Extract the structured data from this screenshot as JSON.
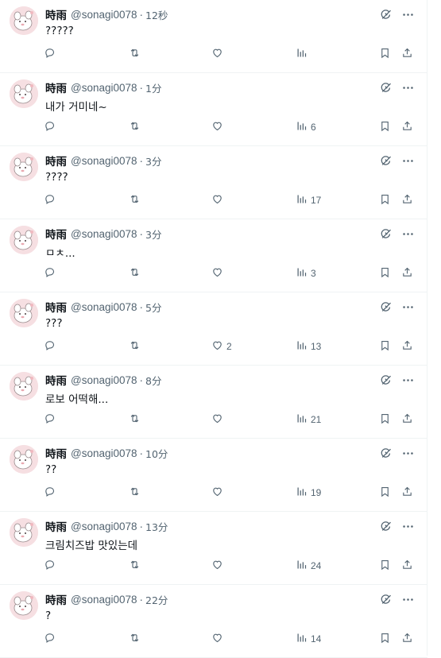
{
  "user": {
    "display_name": "時雨",
    "handle": "@sonagi0078"
  },
  "separator": "·",
  "icons": {
    "avatar": "avatar-image",
    "grok": "grok-icon",
    "more": "more-icon",
    "reply": "reply-icon",
    "retweet": "retweet-icon",
    "like": "like-icon",
    "views": "views-icon",
    "bookmark": "bookmark-icon",
    "share": "share-icon"
  },
  "colors": {
    "text": "#0f1419",
    "muted": "#536471",
    "border": "#eff3f4"
  },
  "tweets": [
    {
      "time": "12秒",
      "text": "?????",
      "likes": "",
      "views": ""
    },
    {
      "time": "1分",
      "text": "내가 거미네~",
      "likes": "",
      "views": "6"
    },
    {
      "time": "3分",
      "text": "????",
      "likes": "",
      "views": "17"
    },
    {
      "time": "3分",
      "text": "ㅁㅊ...",
      "likes": "",
      "views": "3"
    },
    {
      "time": "5分",
      "text": "???",
      "likes": "2",
      "views": "13"
    },
    {
      "time": "8分",
      "text": "로보 어떡해...",
      "likes": "",
      "views": "21"
    },
    {
      "time": "10分",
      "text": "??",
      "likes": "",
      "views": "19"
    },
    {
      "time": "13分",
      "text": "크림치즈밥 맛있는데",
      "likes": "",
      "views": "24"
    },
    {
      "time": "22分",
      "text": "?",
      "likes": "",
      "views": "14"
    }
  ]
}
